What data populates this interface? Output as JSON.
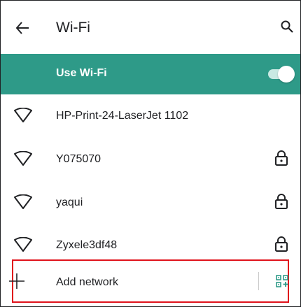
{
  "appbar": {
    "title": "Wi-Fi",
    "back_icon": "arrow-back-icon",
    "search_icon": "search-icon"
  },
  "master_switch": {
    "label": "Use Wi-Fi",
    "state": "on",
    "accent_color": "#2e9a88"
  },
  "networks": [
    {
      "ssid": "HP-Print-24-LaserJet 1102",
      "secured": false
    },
    {
      "ssid": "Y075070",
      "secured": true
    },
    {
      "ssid": "yaqui",
      "secured": true
    },
    {
      "ssid": "Zyxele3df48",
      "secured": true
    }
  ],
  "add_network": {
    "label": "Add network",
    "plus_icon": "plus-icon",
    "qr_icon": "qr-code-scan-icon",
    "highlight_color": "#e0121b"
  }
}
